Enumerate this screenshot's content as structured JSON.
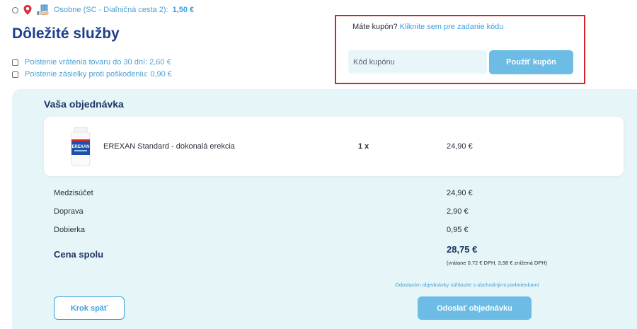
{
  "shipping": {
    "label": "Osobne (SC - Diaľničná cesta 2):",
    "price": "1,50 €"
  },
  "services": {
    "title": "Dôležité služby",
    "items": [
      {
        "label": "Poistenie vrátenia tovaru do 30 dní: 2,60 €"
      },
      {
        "label": "Poistenie zásielky proti poškodeniu: 0,90 €"
      }
    ]
  },
  "coupon": {
    "question": "Máte kupón?",
    "link": "Kliknite sem pre zadanie kódu",
    "placeholder": "Kód kupónu",
    "apply_label": "Použiť kupón"
  },
  "order": {
    "title": "Vaša objednávka",
    "product": {
      "name": "EREXAN Standard - dokonalá erekcia",
      "qty": "1 x",
      "price": "24,90 €",
      "image_text": "EREXAN"
    },
    "summary": [
      {
        "label": "Medzisúčet",
        "value": "24,90 €"
      },
      {
        "label": "Doprava",
        "value": "2,90 €"
      },
      {
        "label": "Dobierka",
        "value": "0,95 €"
      }
    ],
    "total_label": "Cena spolu",
    "total_value": "28,75 €",
    "total_vat": "(vrátane 0,72 € DPH, 3,98 € znížená DPH)",
    "terms_note": "Odoslaním objednávky súhlasíte s obchodnými podmienkami",
    "back_label": "Krok späť",
    "submit_label": "Odoslať objednávku"
  },
  "colors": {
    "accent": "#3aa0e0",
    "button": "#6cbce6",
    "heading": "#1e3f8a",
    "panel": "#e6f5f7",
    "highlight": "#d6212c"
  }
}
